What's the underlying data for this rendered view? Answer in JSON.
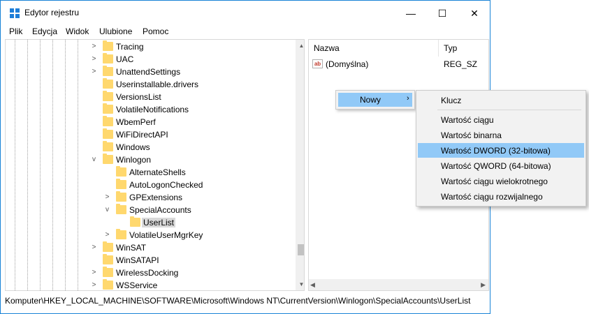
{
  "window": {
    "title": "Edytor rejestru",
    "controls": {
      "minimize": "—",
      "maximize": "☐",
      "close": "✕"
    }
  },
  "menubar": [
    "Plik",
    "Edycja",
    "Widok",
    "Ulubione",
    "Pomoc"
  ],
  "tree": {
    "nodes": [
      {
        "label": "Tracing",
        "expander": ">"
      },
      {
        "label": "UAC",
        "expander": ">"
      },
      {
        "label": "UnattendSettings",
        "expander": ">"
      },
      {
        "label": "Userinstallable.drivers",
        "expander": ""
      },
      {
        "label": "VersionsList",
        "expander": ""
      },
      {
        "label": "VolatileNotifications",
        "expander": ""
      },
      {
        "label": "WbemPerf",
        "expander": ""
      },
      {
        "label": "WiFiDirectAPI",
        "expander": ""
      },
      {
        "label": "Windows",
        "expander": ""
      },
      {
        "label": "Winlogon",
        "expander": "v"
      },
      {
        "label": "AlternateShells",
        "expander": ""
      },
      {
        "label": "AutoLogonChecked",
        "expander": ""
      },
      {
        "label": "GPExtensions",
        "expander": ">"
      },
      {
        "label": "SpecialAccounts",
        "expander": "v"
      },
      {
        "label": "UserList",
        "expander": ""
      },
      {
        "label": "VolatileUserMgrKey",
        "expander": ">"
      },
      {
        "label": "WinSAT",
        "expander": ">"
      },
      {
        "label": "WinSATAPI",
        "expander": ""
      },
      {
        "label": "WirelessDocking",
        "expander": ">"
      },
      {
        "label": "WSService",
        "expander": ">"
      }
    ]
  },
  "list": {
    "columns": {
      "name": "Nazwa",
      "type": "Typ"
    },
    "rows": [
      {
        "icon": "ab",
        "name": "(Domyślna)",
        "type": "REG_SZ"
      }
    ]
  },
  "context_menu": {
    "new_label": "Nowy",
    "arrow": "›",
    "submenu": {
      "key": "Klucz",
      "items": [
        "Wartość ciągu",
        "Wartość binarna",
        "Wartość DWORD (32-bitowa)",
        "Wartość QWORD (64-bitowa)",
        "Wartość ciągu wielokrotnego",
        "Wartość ciągu rozwijalnego"
      ]
    }
  },
  "statusbar": "Komputer\\HKEY_LOCAL_MACHINE\\SOFTWARE\\Microsoft\\Windows NT\\CurrentVersion\\Winlogon\\SpecialAccounts\\UserList",
  "colors": {
    "accent": "#1883d7",
    "highlight": "#91c9f7",
    "folder": "#ffd86e"
  },
  "scroll": {
    "up": "▲",
    "down": "▼",
    "left": "◀",
    "right": "▶"
  }
}
